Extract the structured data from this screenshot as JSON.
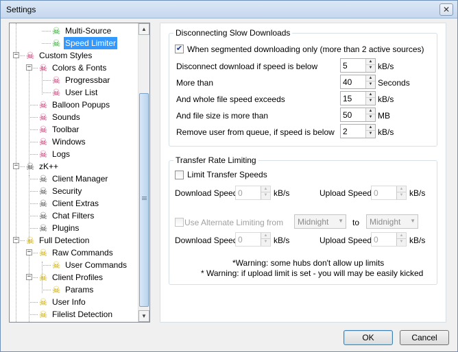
{
  "window": {
    "title": "Settings",
    "close_glyph": "✕"
  },
  "tree": {
    "items": [
      {
        "label": "Multi-Source",
        "icon": "skull-green-icon"
      },
      {
        "label": "Speed Limiter",
        "icon": "skull-green-icon",
        "selected": true
      },
      {
        "label": "Custom Styles",
        "icon": "skull-pink-icon",
        "expander": "−"
      },
      {
        "label": "Colors & Fonts",
        "icon": "skull-pink-icon",
        "expander": "−"
      },
      {
        "label": "Progressbar",
        "icon": "skull-pink-icon"
      },
      {
        "label": "User List",
        "icon": "skull-pink-icon"
      },
      {
        "label": "Balloon Popups",
        "icon": "skull-pink-icon"
      },
      {
        "label": "Sounds",
        "icon": "skull-pink-icon"
      },
      {
        "label": "Toolbar",
        "icon": "skull-pink-icon"
      },
      {
        "label": "Windows",
        "icon": "skull-pink-icon"
      },
      {
        "label": "Logs",
        "icon": "skull-pink-icon"
      },
      {
        "label": "zK++",
        "icon": "skull-grey-icon",
        "expander": "−"
      },
      {
        "label": "Client Manager",
        "icon": "skull-grey-icon"
      },
      {
        "label": "Security",
        "icon": "skull-grey-icon"
      },
      {
        "label": "Client Extras",
        "icon": "skull-grey-icon"
      },
      {
        "label": "Chat Filters",
        "icon": "skull-grey-icon"
      },
      {
        "label": "Plugins",
        "icon": "skull-grey-icon"
      },
      {
        "label": "Full Detection",
        "icon": "skull-yellow-icon",
        "expander": "−"
      },
      {
        "label": "Raw Commands",
        "icon": "skull-yellow-icon",
        "expander": "−"
      },
      {
        "label": "User Commands",
        "icon": "skull-yellow-icon"
      },
      {
        "label": "Client Profiles",
        "icon": "skull-yellow-icon",
        "expander": "−"
      },
      {
        "label": "Params",
        "icon": "skull-yellow-icon"
      },
      {
        "label": "User Info",
        "icon": "skull-yellow-icon"
      },
      {
        "label": "Filelist Detection",
        "icon": "skull-yellow-icon"
      }
    ],
    "scroll_up": "▲",
    "scroll_down": "▼"
  },
  "slow": {
    "group_label": "Disconnecting Slow Downloads",
    "segmented_label": "When segmented downloading only (more than 2 active sources)",
    "segmented_checked": "✔",
    "rows": [
      {
        "label": "Disconnect download if speed is below",
        "value": "5",
        "unit": "kB/s"
      },
      {
        "label": "More than",
        "value": "40",
        "unit": "Seconds"
      },
      {
        "label": "And whole file speed exceeds",
        "value": "15",
        "unit": "kB/s"
      },
      {
        "label": "And file size is more than",
        "value": "50",
        "unit": "MB"
      },
      {
        "label": "Remove user from queue, if speed is below",
        "value": "2",
        "unit": "kB/s"
      }
    ]
  },
  "rate": {
    "group_label": "Transfer Rate Limiting",
    "limit_label": "Limit Transfer Speeds",
    "download_label": "Download Speed",
    "upload_label": "Upload Speed",
    "unit": "kB/s",
    "download_value": "0",
    "upload_value": "0",
    "alt_label": "Use Alternate Limiting from",
    "from_value": "Midnight",
    "to_label": "to",
    "to_value": "Midnight",
    "alt_download_value": "0",
    "alt_upload_value": "0",
    "warning1": "*Warning: some hubs don't allow up limits",
    "warning2": "* Warning: if upload limit is set - you will may be easily kicked"
  },
  "spin": {
    "up": "▲",
    "down": "▼"
  },
  "combo_arrow": "▼",
  "buttons": {
    "ok": "OK",
    "cancel": "Cancel"
  },
  "icons": {
    "skull": "☠"
  }
}
